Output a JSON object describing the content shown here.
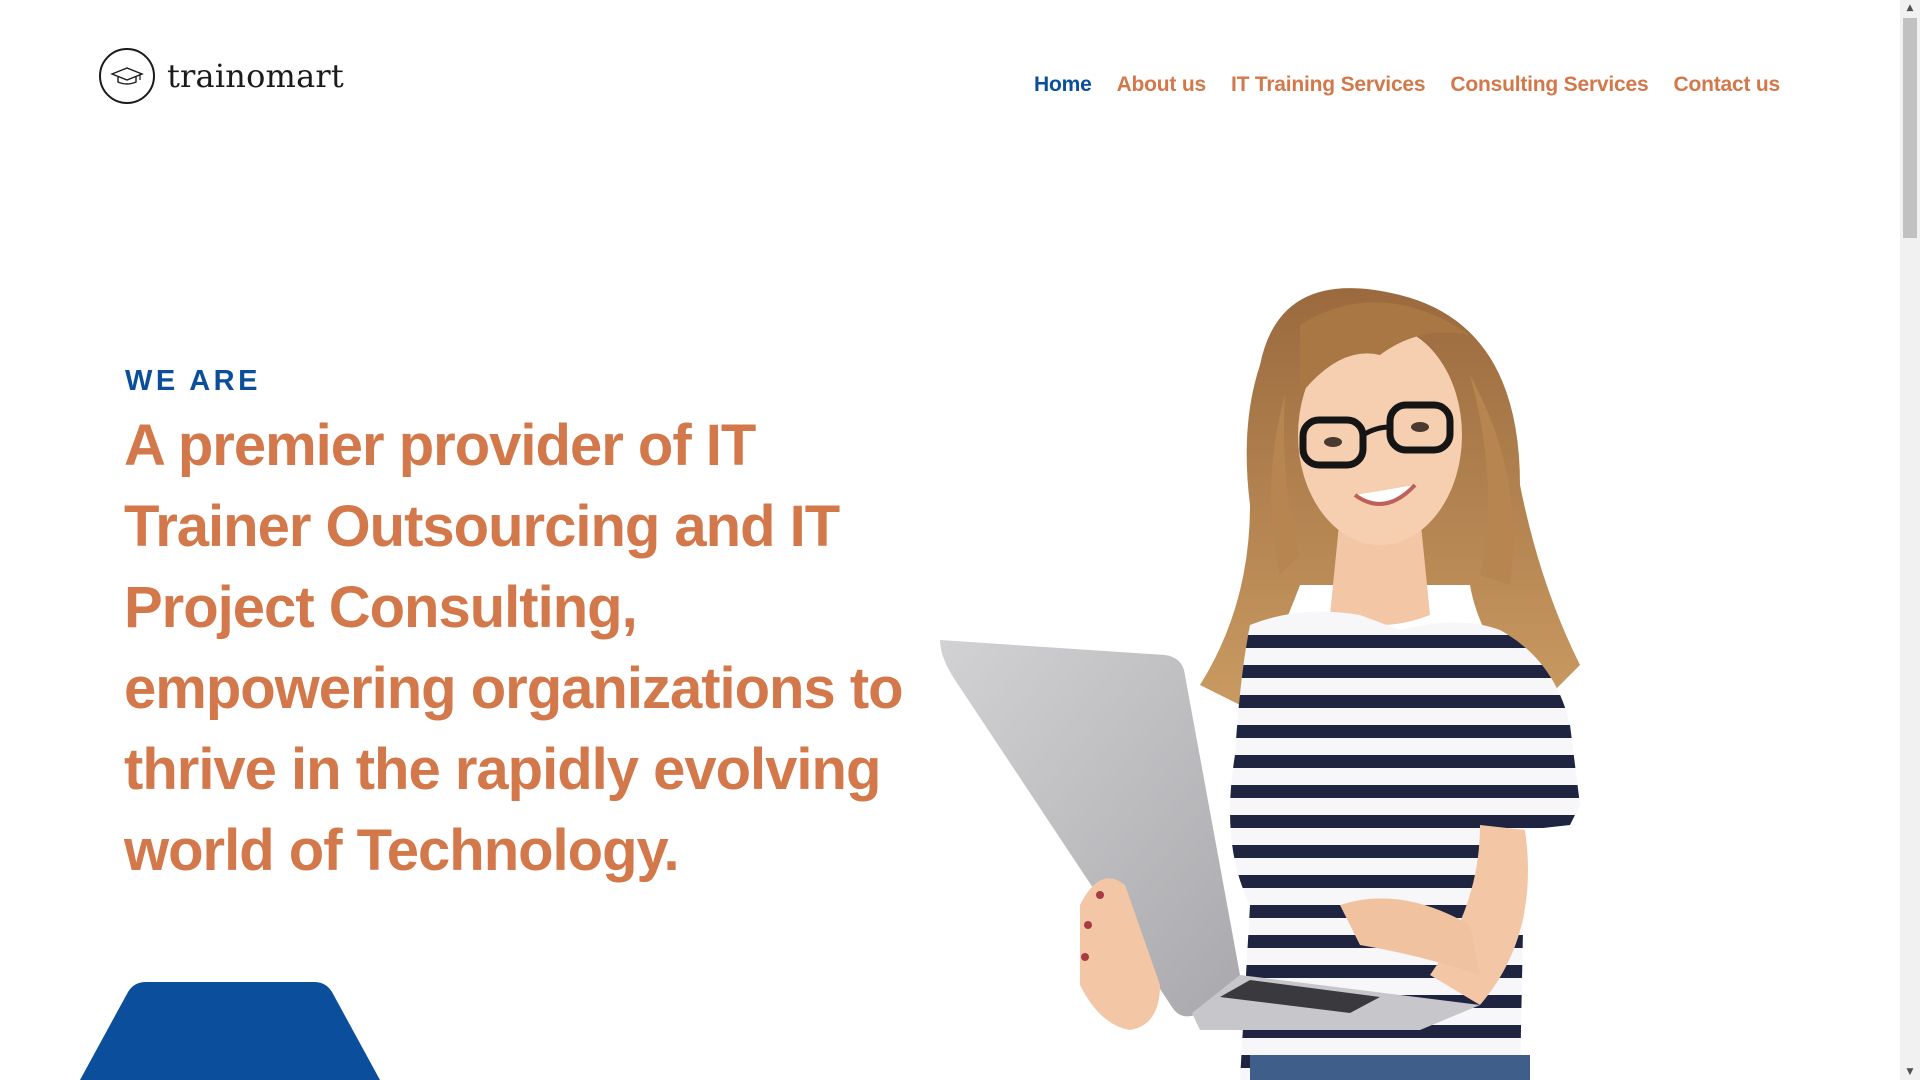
{
  "header": {
    "logo_text": "trainomart",
    "nav": [
      {
        "label": "Home",
        "active": true
      },
      {
        "label": "About us",
        "active": false
      },
      {
        "label": "IT Training Services",
        "active": false
      },
      {
        "label": "Consulting Services",
        "active": false
      },
      {
        "label": "Contact us",
        "active": false
      }
    ]
  },
  "hero": {
    "eyebrow": "WE ARE",
    "headline": "A premier provider of IT Trainer Outsourcing and IT Project Consulting, empowering organizations to thrive in the rapidly evolving world of Technology."
  },
  "icons": {
    "logo": "graduation-cap-icon",
    "scroll_up": "▲",
    "scroll_down": "▼"
  },
  "colors": {
    "brand_blue": "#0b4f9c",
    "accent_orange": "#d3784a"
  }
}
